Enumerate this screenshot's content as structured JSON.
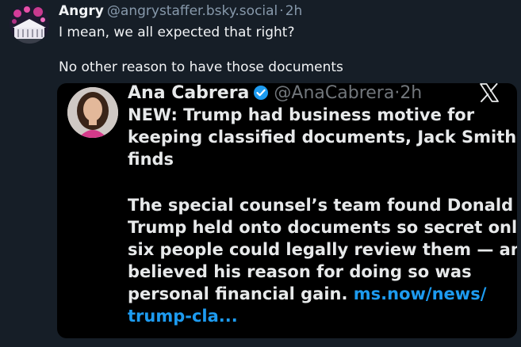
{
  "post": {
    "author": {
      "display_name": "Angry",
      "handle": "@angrystaffer.bsky.social",
      "separator": "·",
      "time": "2h"
    },
    "text_lines": [
      "I mean, we all expected that right?",
      "No other reason to have those documents"
    ]
  },
  "embed": {
    "author": {
      "name": "Ana Cabrera",
      "handle": "@AnaCabrera",
      "separator": "·",
      "time": "2h"
    },
    "body_lines": [
      "NEW: Trump had business motive for",
      "keeping classified documents, Jack Smith",
      "finds",
      "The special counsel’s team found Donald",
      "Trump held onto documents so secret only",
      "six people could legally review them — and",
      "believed his reason for doing so was"
    ],
    "last_line_text": "personal financial gain.",
    "link_part1": "ms.now/news/",
    "link_part2": "trump-cla...",
    "icons": {
      "verified": "verified-badge-icon",
      "platform": "x-logo-icon"
    }
  },
  "colors": {
    "background": "#161e27",
    "embed_background": "#000000",
    "text": "#f1f3f5",
    "muted": "#8799ab",
    "link": "#1d9bf0",
    "verified": "#1d9bf0"
  }
}
